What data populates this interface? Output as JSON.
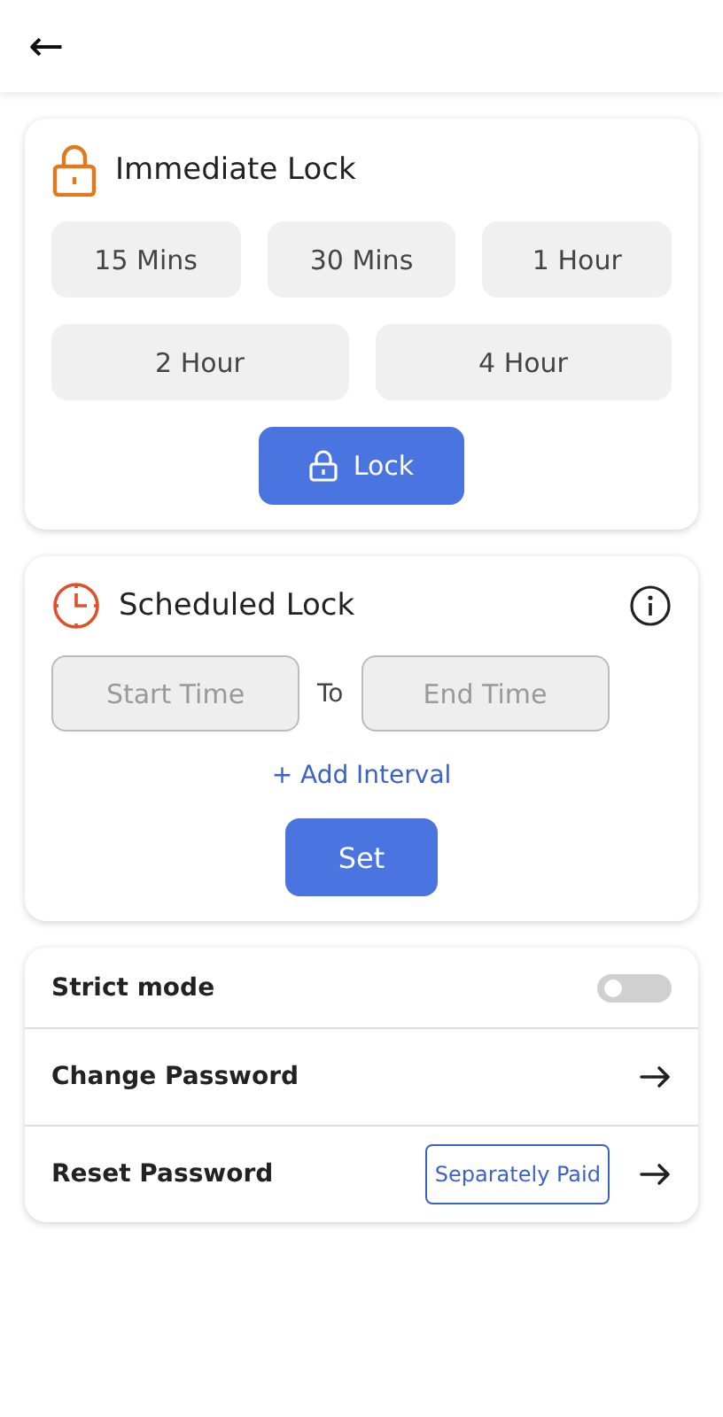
{
  "header": {
    "back": "←"
  },
  "immediate_lock": {
    "title": "Immediate Lock",
    "durations": [
      {
        "label": "15 Mins",
        "selected": false
      },
      {
        "label": "30 Mins",
        "selected": false
      },
      {
        "label": "1 Hour",
        "selected": false
      },
      {
        "label": "2 Hour",
        "selected": false
      },
      {
        "label": "4 Hour",
        "selected": false
      }
    ],
    "button": "Lock"
  },
  "scheduled_lock": {
    "title": "Scheduled Lock",
    "start": {
      "placeholder": "Start Time"
    },
    "separator": "To",
    "end": {
      "placeholder": "End Time"
    },
    "add_interval": "+ Add Interval",
    "button": "Set"
  },
  "settings": [
    {
      "kind": "toggle",
      "label": "Strict mode",
      "on": false
    },
    {
      "kind": "link",
      "label": "Change Password"
    },
    {
      "kind": "link",
      "label": "Reset Password",
      "badge": "Separately Paid"
    }
  ]
}
